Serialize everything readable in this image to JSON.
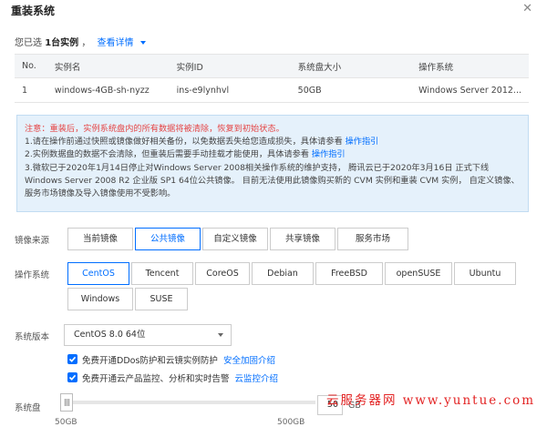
{
  "dialog": {
    "title": "重装系统"
  },
  "summary": {
    "prefix": "您已选",
    "count": "1台实例",
    "sep": "，",
    "view_details": "查看详情"
  },
  "table": {
    "headers": [
      "No.",
      "实例名",
      "实例ID",
      "系统盘大小",
      "操作系统"
    ],
    "rows": [
      [
        "1",
        "windows-4GB-sh-nyzz",
        "ins-e9lynhvl",
        "50GB",
        "Windows Server 2012..."
      ]
    ]
  },
  "notice": {
    "warning": "注意：重装后，实例系统盘内的所有数据将被清除，恢复到初始状态。",
    "line1": "1.请在操作前通过快照或镜像做好相关备份，以免数据丢失给您造成损失，具体请参看",
    "line1_link": "操作指引",
    "line2": "2.实例数据盘的数据不会清除，但重装后需要手动挂载才能使用，具体请参看",
    "line2_link": "操作指引",
    "line3": "3.微软已于2020年1月14日停止对Windows Server 2008相关操作系统的维护支持， 腾讯云已于2020年3月16日 正式下线",
    "line4": "Windows Server 2008 R2 企业版 SP1 64位公共镜像。 目前无法使用此镜像购买新的 CVM 实例和重装 CVM 实例， 自定义镜像、",
    "line5": "服务市场镜像及导入镜像使用不受影响。"
  },
  "image_source": {
    "label": "镜像来源",
    "options": [
      "当前镜像",
      "公共镜像",
      "自定义镜像",
      "共享镜像",
      "服务市场"
    ],
    "selected": "公共镜像"
  },
  "os": {
    "label": "操作系统",
    "row1": [
      "CentOS",
      "Tencent",
      "CoreOS",
      "Debian",
      "FreeBSD",
      "openSUSE",
      "Ubuntu"
    ],
    "row2": [
      "Windows",
      "SUSE"
    ],
    "selected": "CentOS"
  },
  "version": {
    "label": "系统版本",
    "value": "CentOS 8.0 64位"
  },
  "options": [
    {
      "checked": true,
      "text": "免费开通DDos防护和云镜实例防护",
      "link": "安全加固介绍"
    },
    {
      "checked": true,
      "text": "免费开通云产品监控、分析和实时告警",
      "link": "云监控介绍"
    }
  ],
  "disk": {
    "label": "系统盘",
    "value": "50",
    "unit": "GB",
    "min_label": "50GB",
    "max_label": "500GB"
  },
  "watermark": {
    "text": "云服务器网 www.yuntue.com"
  },
  "colors": {
    "accent": "#006eff",
    "warning": "#e54545",
    "notice_bg": "#e5f1fb"
  },
  "icons": {
    "close": "close-icon",
    "caret": "chevron-down-icon",
    "check": "check-icon"
  }
}
